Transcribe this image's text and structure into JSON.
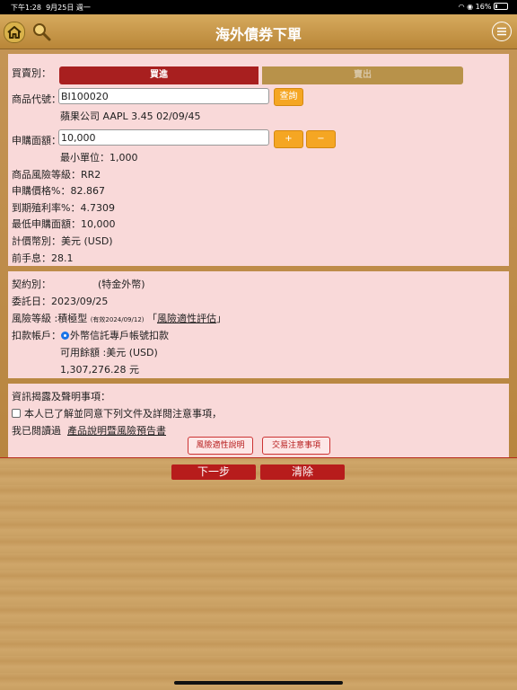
{
  "status_bar": {
    "time": "下午1:28",
    "date": "9月25日 週一",
    "battery": "16%"
  },
  "header": {
    "title": "海外債券下單"
  },
  "order": {
    "trade_type_label": "買賣別：",
    "buy_label": "買進",
    "sell_label": "賣出",
    "product_code_label": "商品代號：",
    "product_code_value": "BI100020",
    "query_button": "查詢",
    "product_name": "蘋果公司 AAPL 3.45 02/09/45",
    "amount_label": "申購面額：",
    "amount_value": "10,000",
    "plus_button": "+",
    "minus_button": "−",
    "min_unit": "最小單位：1,000",
    "risk_level": "商品風險等級：RR2",
    "price": "申購價格%：82.867",
    "yield": "到期殖利率%：4.7309",
    "min_amount": "最低申購面額：10,000",
    "currency": "計價幣別：美元 (USD)",
    "accrued_interest": "前手息：28.1"
  },
  "contract": {
    "contract_label": "契約別：",
    "contract_value": "(特金外幣)",
    "date": "委託日：2023/09/25",
    "risk_prefix": "風險等級 :積極型",
    "risk_valid": "(有效2024/09/12)",
    "risk_link_open": "「",
    "risk_link": "風險適性評估",
    "risk_link_close": "」",
    "debit_label": "扣款帳戶：",
    "debit_option": "外幣信託專戶帳號扣款",
    "available_label": "可用餘額 :美元 (USD)",
    "available_value": "1,307,276.28 元"
  },
  "disclosure": {
    "title": "資訊揭露及聲明事項：",
    "agree_text": "本人已了解並同意下列文件及詳閱注意事項，",
    "read_prefix": "我已閱讀過",
    "read_link": "產品說明暨風險預告書",
    "risk_fit_button": "風險適性說明",
    "trade_notice_button": "交易注意事項"
  },
  "actions": {
    "next_button": "下一步",
    "clear_button": "清除"
  }
}
